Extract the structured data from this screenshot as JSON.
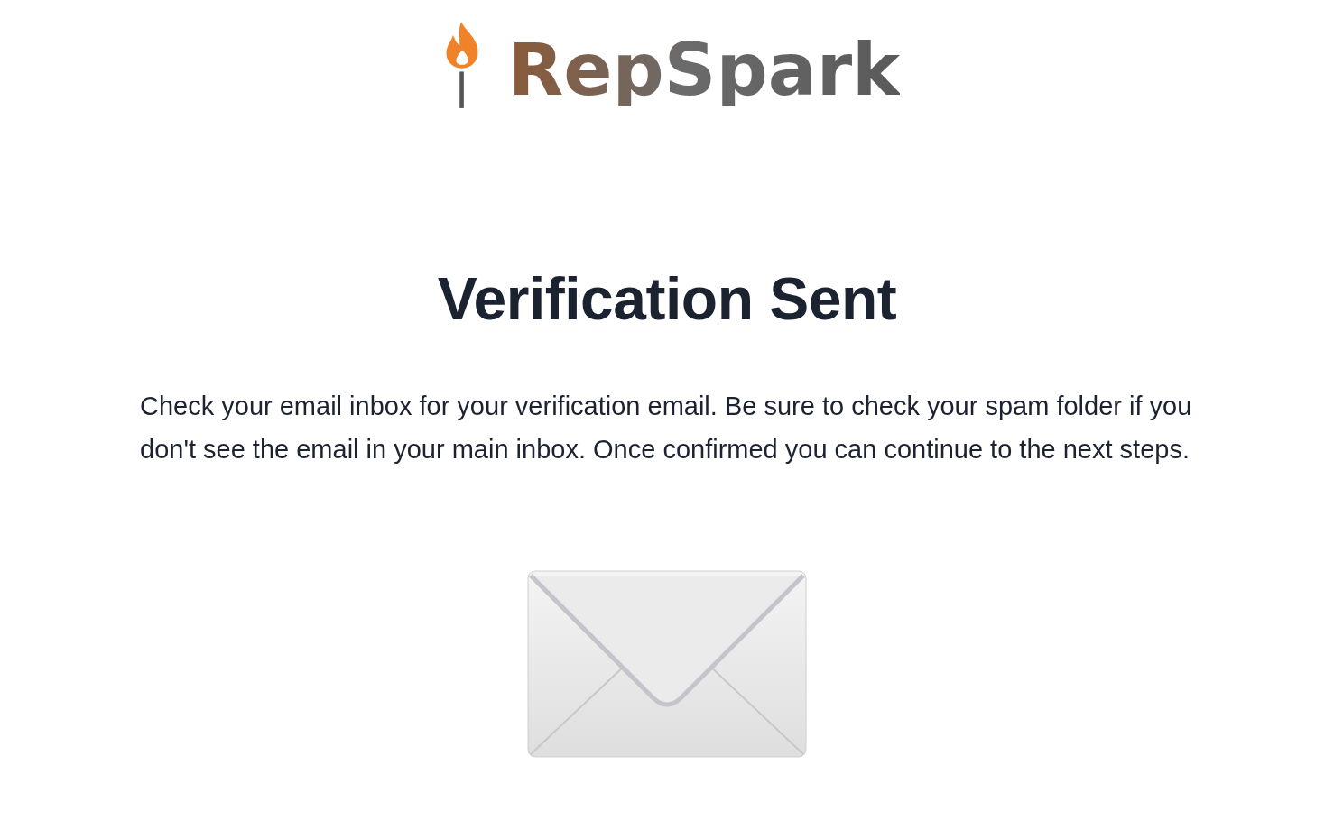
{
  "logo": {
    "text": "RepSpark"
  },
  "title": "Verification Sent",
  "message": "Check your email inbox for your verification email. Be sure to check your spam folder if you don't see the email in your main inbox. Once confirmed you can continue to the next steps."
}
